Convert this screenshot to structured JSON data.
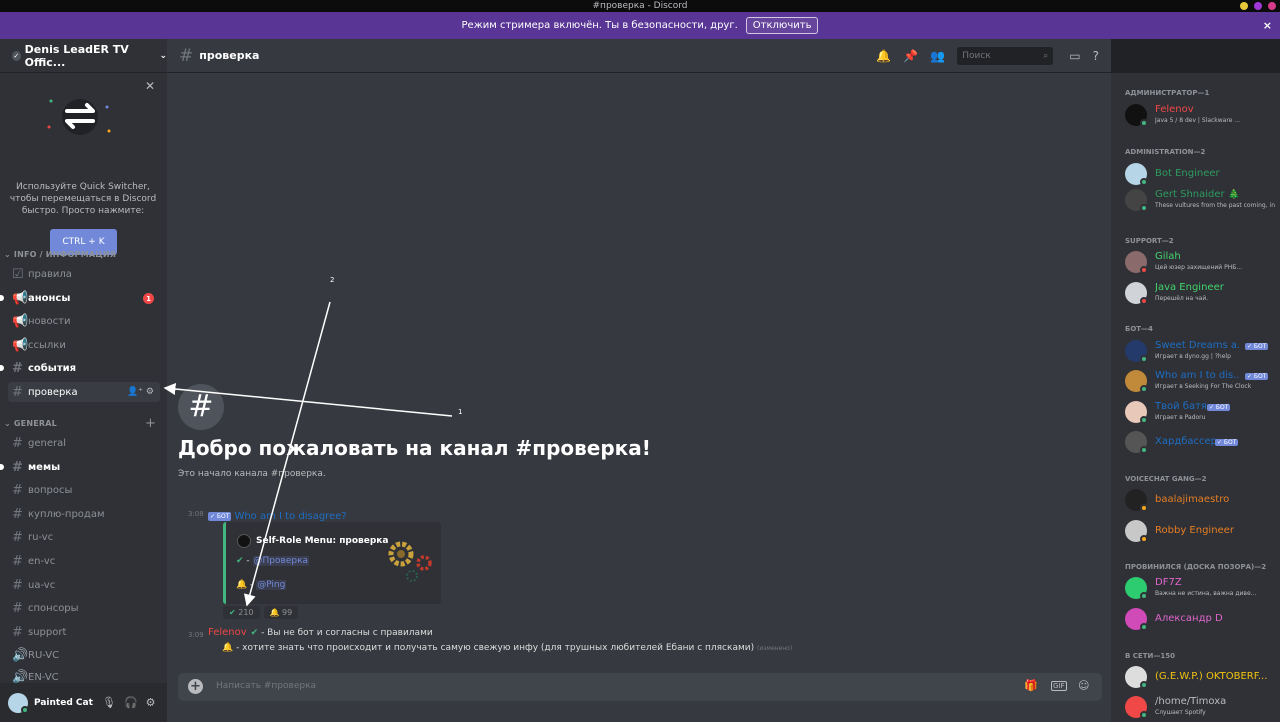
{
  "window": {
    "title": "#проверка - Discord",
    "dots": [
      "#e6c83a",
      "#a038d8",
      "#d83a8a"
    ]
  },
  "banner": {
    "text": "Режим стримера включён. Ты в безопасности, друг.",
    "button": "Отключить",
    "close": "×"
  },
  "server": {
    "name": "Denis LeadER TV Offic..."
  },
  "quick_switcher": {
    "text": "Используйте Quick Switcher, чтобы перемещаться в Discord быстро. Просто нажмите:",
    "button": "CTRL + K"
  },
  "categories": [
    {
      "label": "INFO / ИНФОРМАЦИЯ"
    },
    {
      "label": "GENERAL"
    }
  ],
  "channels": [
    {
      "name": "правила",
      "icon": "rules-icon",
      "unread": false,
      "badge": ""
    },
    {
      "name": "анонсы",
      "icon": "megaphone-icon",
      "unread": true,
      "badge": "1"
    },
    {
      "name": "новости",
      "icon": "megaphone-icon",
      "unread": false,
      "badge": ""
    },
    {
      "name": "ссылки",
      "icon": "megaphone-icon",
      "unread": false,
      "badge": ""
    },
    {
      "name": "события",
      "icon": "hash-icon",
      "unread": true,
      "badge": ""
    },
    {
      "name": "проверка",
      "icon": "hash-icon",
      "unread": false,
      "badge": "",
      "active": true
    },
    {
      "name": "general",
      "icon": "hash-icon",
      "unread": false
    },
    {
      "name": "мемы",
      "icon": "hash-icon",
      "unread": true
    },
    {
      "name": "вопросы",
      "icon": "hash-icon",
      "unread": false
    },
    {
      "name": "куплю-продам",
      "icon": "hash-icon",
      "unread": false
    },
    {
      "name": "ru-vc",
      "icon": "hash-icon",
      "unread": false
    },
    {
      "name": "en-vc",
      "icon": "hash-icon",
      "unread": false
    },
    {
      "name": "ua-vc",
      "icon": "hash-icon",
      "unread": false
    },
    {
      "name": "спонсоры",
      "icon": "hash-icon",
      "unread": false
    },
    {
      "name": "support",
      "icon": "hash-icon",
      "unread": false
    },
    {
      "name": "RU-VC",
      "icon": "voice-icon",
      "unread": false
    },
    {
      "name": "EN-VC",
      "icon": "voice-icon",
      "unread": false
    }
  ],
  "user": {
    "name": "Painted Cat"
  },
  "channel_header": {
    "name": "проверка",
    "search_placeholder": "Поиск"
  },
  "welcome": {
    "title": "Добро пожаловать на канал #проверка!",
    "subtitle": "Это начало канала #проверка."
  },
  "messages": {
    "bot": {
      "time": "3:08",
      "tag": "✓ БОТ",
      "author": "Who am I to disagree?",
      "embed_title": "Self-Role Menu: проверка",
      "line1_sep": " - ",
      "line1_role": "@Проверка",
      "line2_sep": " - ",
      "line2_role": "@Ping",
      "reactions": [
        {
          "emoji": "✔",
          "count": "210"
        },
        {
          "emoji": "🔔",
          "count": "99"
        }
      ]
    },
    "felenov": {
      "time": "3:09",
      "author": "Felenov",
      "line1": "- Вы не бот и согласны с правилами",
      "line2": "- хотите знать что происходит и получать самую свежую инфу (для трушных любителей Ебани с плясками)",
      "edited": "(изменено)"
    }
  },
  "composer": {
    "placeholder": "Написать #проверка"
  },
  "annotations": {
    "one": "1",
    "two": "2"
  },
  "members": {
    "categories": [
      "АДМИНИСТРАТОР—1",
      "ADMINISTRATION—2",
      "SUPPORT—2",
      "БОТ—4",
      "VOICECHAT GANG—2",
      "ПРОВИНИЛСЯ (ДОСКА ПОЗОРА)—2",
      "В СЕТИ—150"
    ],
    "list": [
      {
        "name": "Felenov",
        "sub": "Java 5 / 8 dev | Slackware ...",
        "color": "#f04747",
        "avatar": "#111111",
        "status": "#43b581"
      },
      {
        "name": "Bot Engineer",
        "sub": "",
        "color": "#2e9b5f",
        "avatar": "#b6d5e6",
        "status": "#43b581"
      },
      {
        "name": "Gert Shnaider 🎄",
        "sub": "These vultures from the past coming, in e...",
        "color": "#2e9b5f",
        "avatar": "#444444",
        "status": "#43b581"
      },
      {
        "name": "Gilah",
        "sub": "Цей юзер захищений PHБ...",
        "color": "#43d36b",
        "avatar": "#8a6a6a",
        "status": "#f04747"
      },
      {
        "name": "Java Engineer",
        "sub": "Перешёл на чай.",
        "color": "#43d36b",
        "avatar": "#d0d4d8",
        "status": "#f04747"
      },
      {
        "name": "Sweet Dreams a...",
        "sub": "Играет в dyno.gg | ?help",
        "color": "#1e6ec4",
        "avatar": "#233a6a",
        "status": "#43b581",
        "bot": "✓ БОТ"
      },
      {
        "name": "Who am I to dis...",
        "sub": "Играет в Seeking For The Clock",
        "color": "#1e6ec4",
        "avatar": "#c08a3a",
        "status": "#43b581",
        "bot": "✓ БОТ"
      },
      {
        "name": "Твой батя",
        "sub": "Играет в Padoru",
        "color": "#1e6ec4",
        "avatar": "#e8c8b8",
        "status": "#43b581",
        "bot": "✓ БОТ"
      },
      {
        "name": "Хардбассер",
        "sub": "",
        "color": "#1e6ec4",
        "avatar": "#555555",
        "status": "#43b581",
        "bot": "✓ БОТ"
      },
      {
        "name": "baalajimaestro",
        "sub": "",
        "color": "#e67e22",
        "avatar": "#222222",
        "status": "#faa61a"
      },
      {
        "name": "Robby Engineer",
        "sub": "",
        "color": "#e67e22",
        "avatar": "#c8c8c8",
        "status": "#faa61a"
      },
      {
        "name": "DF7Z",
        "sub": "Важна не истина, важна диве...",
        "color": "#e066cc",
        "avatar": "#2ecc71",
        "status": "#43b581"
      },
      {
        "name": "Александр D",
        "sub": "",
        "color": "#e066cc",
        "avatar": "#d04ab8",
        "status": "#43b581"
      },
      {
        "name": "(G.E.W.P.) OKTOBERF...",
        "sub": "",
        "color": "#f1c40f",
        "avatar": "#dddddd",
        "status": "#43b581"
      },
      {
        "name": "/home/Timoxa",
        "sub": "Слушает Spotify",
        "color": "#b9bbbe",
        "avatar": "#f04747",
        "status": "#43b581"
      }
    ]
  }
}
